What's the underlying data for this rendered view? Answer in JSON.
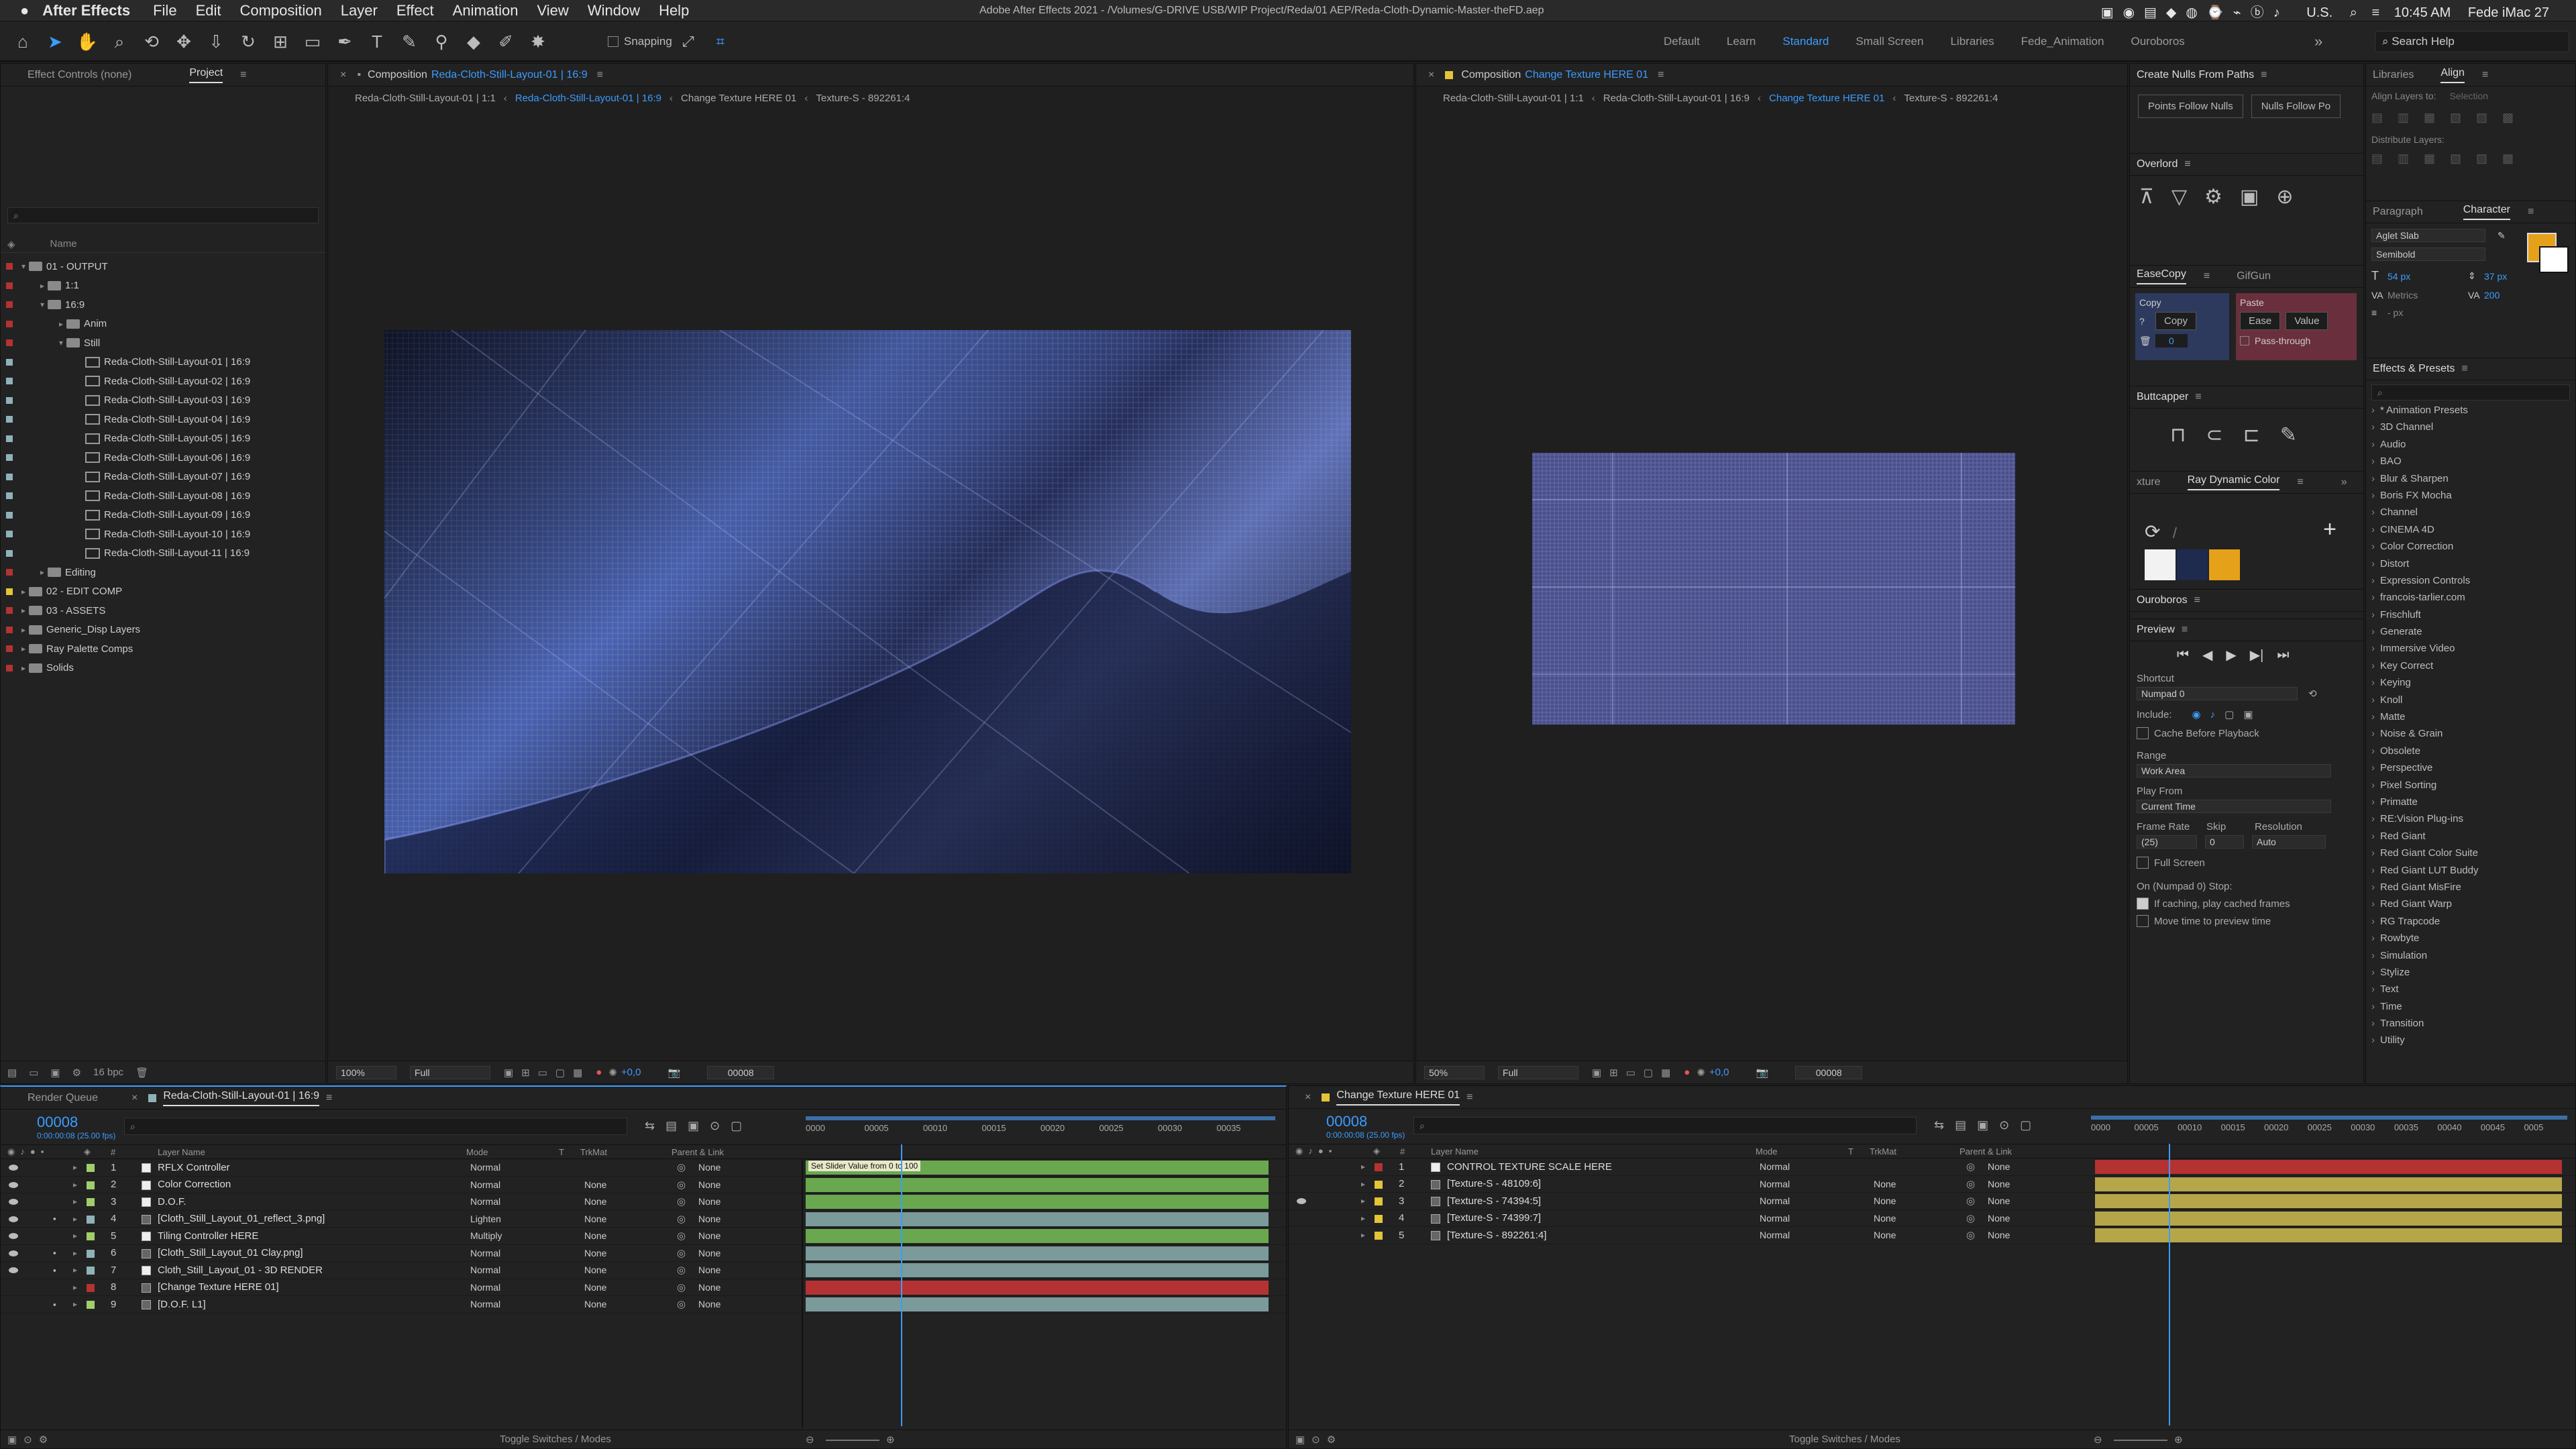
{
  "menubar": {
    "apple": "",
    "app": "After Effects",
    "items": [
      "File",
      "Edit",
      "Composition",
      "Layer",
      "Effect",
      "Animation",
      "View",
      "Window",
      "Help"
    ],
    "title": "Adobe After Effects 2021 - /Volumes/G-DRIVE USB/WIP Project/Reda/01 AEP/Reda-Cloth-Dynamic-Master-theFD.aep",
    "status": {
      "region": "U.S.",
      "time": "10:45 AM",
      "user": "Fede iMac 27"
    }
  },
  "toolbar": {
    "snapping": "Snapping",
    "workspaces": [
      "Default",
      "Learn",
      "Standard",
      "Small Screen",
      "Libraries",
      "Fede_Animation",
      "Ouroboros"
    ],
    "active_workspace": "Standard",
    "search": "Search Help"
  },
  "project_panel": {
    "tabs": [
      "Effect Controls (none)",
      "Project"
    ],
    "col_name": "Name",
    "search_placeholder": "",
    "items": [
      {
        "label": "01 - OUTPUT",
        "indent": 0,
        "type": "folder",
        "color": "#b43232",
        "open": true
      },
      {
        "label": "1:1",
        "indent": 1,
        "type": "folder",
        "color": "#b43232",
        "open": false
      },
      {
        "label": "16:9",
        "indent": 1,
        "type": "folder",
        "color": "#b43232",
        "open": true
      },
      {
        "label": "Anim",
        "indent": 2,
        "type": "folder",
        "color": "#b43232",
        "open": false
      },
      {
        "label": "Still",
        "indent": 2,
        "type": "folder",
        "color": "#b43232",
        "open": true
      },
      {
        "label": "Reda-Cloth-Still-Layout-01 | 16:9",
        "indent": 3,
        "type": "comp",
        "color": "#8fb2b9"
      },
      {
        "label": "Reda-Cloth-Still-Layout-02 | 16:9",
        "indent": 3,
        "type": "comp",
        "color": "#8fb2b9"
      },
      {
        "label": "Reda-Cloth-Still-Layout-03 | 16:9",
        "indent": 3,
        "type": "comp",
        "color": "#8fb2b9"
      },
      {
        "label": "Reda-Cloth-Still-Layout-04 | 16:9",
        "indent": 3,
        "type": "comp",
        "color": "#8fb2b9"
      },
      {
        "label": "Reda-Cloth-Still-Layout-05 | 16:9",
        "indent": 3,
        "type": "comp",
        "color": "#8fb2b9"
      },
      {
        "label": "Reda-Cloth-Still-Layout-06 | 16:9",
        "indent": 3,
        "type": "comp",
        "color": "#8fb2b9"
      },
      {
        "label": "Reda-Cloth-Still-Layout-07 | 16:9",
        "indent": 3,
        "type": "comp",
        "color": "#8fb2b9"
      },
      {
        "label": "Reda-Cloth-Still-Layout-08 | 16:9",
        "indent": 3,
        "type": "comp",
        "color": "#8fb2b9"
      },
      {
        "label": "Reda-Cloth-Still-Layout-09 | 16:9",
        "indent": 3,
        "type": "comp",
        "color": "#8fb2b9"
      },
      {
        "label": "Reda-Cloth-Still-Layout-10 | 16:9",
        "indent": 3,
        "type": "comp",
        "color": "#8fb2b9"
      },
      {
        "label": "Reda-Cloth-Still-Layout-11 | 16:9",
        "indent": 3,
        "type": "comp",
        "color": "#8fb2b9"
      },
      {
        "label": "Editing",
        "indent": 1,
        "type": "folder",
        "color": "#b43232",
        "open": false
      },
      {
        "label": "02 - EDIT COMP",
        "indent": 0,
        "type": "folder",
        "color": "#e3c537",
        "open": false
      },
      {
        "label": "03 - ASSETS",
        "indent": 0,
        "type": "folder",
        "color": "#b43232",
        "open": false
      },
      {
        "label": "Generic_Disp Layers",
        "indent": 0,
        "type": "folder",
        "color": "#b43232",
        "open": false
      },
      {
        "label": "Ray Palette Comps",
        "indent": 0,
        "type": "folder",
        "color": "#b43232",
        "open": false
      },
      {
        "label": "Solids",
        "indent": 0,
        "type": "folder",
        "color": "#b43232",
        "open": false
      }
    ],
    "bpc": "16 bpc"
  },
  "viewer_left": {
    "title_prefix": "Composition",
    "title": "Reda-Cloth-Still-Layout-01 | 16:9",
    "crumbs": [
      "Reda-Cloth-Still-Layout-01 | 1:1",
      "Reda-Cloth-Still-Layout-01 | 16:9",
      "Change Texture HERE 01",
      "Texture-S - 892261:4"
    ],
    "zoom": "100%",
    "res": "Full",
    "exposure": "+0,0",
    "frame": "00008"
  },
  "viewer_right": {
    "title_prefix": "Composition",
    "title": "Change Texture HERE 01",
    "crumbs": [
      "Reda-Cloth-Still-Layout-01 | 1:1",
      "Reda-Cloth-Still-Layout-01 | 16:9",
      "Change Texture HERE 01",
      "Texture-S - 892261:4"
    ],
    "zoom": "50%",
    "res": "Full",
    "exposure": "+0,0",
    "frame": "00008"
  },
  "right_col": {
    "nulls": {
      "title": "Create Nulls From Paths",
      "b1": "Points Follow Nulls",
      "b2": "Nulls Follow Po"
    },
    "overlord": "Overlord",
    "easecopy": {
      "tabs": [
        "EaseCopy",
        "GifGun"
      ],
      "copy": "Copy",
      "copy_btn": "Copy",
      "q": "?",
      "num": "0",
      "paste": "Paste",
      "ease": "Ease",
      "value": "Value",
      "pass": "Pass-through"
    },
    "buttcapper": "Buttcapper",
    "raydyn": {
      "tab_left": "xture",
      "title": "Ray Dynamic Color"
    },
    "ouroboros": "Ouroboros",
    "preview": {
      "title": "Preview",
      "shortcut_label": "Shortcut",
      "shortcut": "Numpad 0",
      "include": "Include:",
      "cache": "Cache Before Playback",
      "range_label": "Range",
      "range": "Work Area",
      "playfrom_label": "Play From",
      "playfrom": "Current Time",
      "fr_label": "Frame Rate",
      "skip_label": "Skip",
      "res_label": "Resolution",
      "fr": "(25)",
      "skip": "0",
      "res": "Auto",
      "fullscreen": "Full Screen",
      "stop_label": "On (Numpad 0) Stop:",
      "opt1": "If caching, play cached frames",
      "opt2": "Move time to preview time"
    }
  },
  "far_right": {
    "tabs": [
      "Libraries",
      "Align"
    ],
    "align_to": "Align Layers to:",
    "selection": "Selection",
    "distribute": "Distribute Layers:",
    "para_tabs": [
      "Paragraph",
      "Character"
    ],
    "font": "Aglet Slab",
    "style": "Semibold",
    "size": "54 px",
    "leading": "37 px",
    "metrics": "Metrics",
    "tracking": "200",
    "unit": "- px",
    "effects_title": "Effects & Presets",
    "effects": [
      "* Animation Presets",
      "3D Channel",
      "Audio",
      "BAO",
      "Blur & Sharpen",
      "Boris FX Mocha",
      "Channel",
      "CINEMA 4D",
      "Color Correction",
      "Distort",
      "Expression Controls",
      "francois-tarlier.com",
      "Frischluft",
      "Generate",
      "Immersive Video",
      "Key Correct",
      "Keying",
      "Knoll",
      "Matte",
      "Noise & Grain",
      "Obsolete",
      "Perspective",
      "Pixel Sorting",
      "Primatte",
      "RE:Vision Plug-ins",
      "Red Giant",
      "Red Giant Color Suite",
      "Red Giant LUT Buddy",
      "Red Giant MisFire",
      "Red Giant Warp",
      "RG Trapcode",
      "Rowbyte",
      "Simulation",
      "Stylize",
      "Text",
      "Time",
      "Transition",
      "Utility"
    ]
  },
  "timeline_left": {
    "tabs": [
      "Render Queue",
      "Reda-Cloth-Still-Layout-01 | 16:9"
    ],
    "timecode": "00008",
    "fps": "0:00:00:08 (25.00 fps)",
    "cols": {
      "name": "Layer Name",
      "mode": "Mode",
      "t": "T",
      "trk": "TrkMat",
      "parent": "Parent & Link"
    },
    "ruler": [
      "0000",
      "00005",
      "00010",
      "00015",
      "00020",
      "00025",
      "00030",
      "00035"
    ],
    "tooltip": "Set Slider Value from 0 to 100",
    "layers": [
      {
        "n": "1",
        "name": "RFLX Controller",
        "mode": "Normal",
        "trk": "",
        "parent": "None",
        "color": "#9fcf6b",
        "bar": "#6aa84f",
        "eye": true,
        "lock": false
      },
      {
        "n": "2",
        "name": "Color Correction",
        "mode": "Normal",
        "trk": "None",
        "parent": "None",
        "color": "#9fcf6b",
        "bar": "#6aa84f",
        "eye": true,
        "lock": false
      },
      {
        "n": "3",
        "name": "D.O.F.",
        "mode": "Normal",
        "trk": "None",
        "parent": "None",
        "color": "#9fcf6b",
        "bar": "#6aa84f",
        "eye": true,
        "lock": false
      },
      {
        "n": "4",
        "name": "[Cloth_Still_Layout_01_reflect_3.png]",
        "mode": "Lighten",
        "trk": "None",
        "parent": "None",
        "color": "#8fb2b9",
        "bar": "#7b9a9a",
        "eye": true,
        "lock": true
      },
      {
        "n": "5",
        "name": "Tiling Controller HERE",
        "mode": "Multiply",
        "trk": "None",
        "parent": "None",
        "color": "#9fcf6b",
        "bar": "#6aa84f",
        "eye": true,
        "lock": false
      },
      {
        "n": "6",
        "name": "[Cloth_Still_Layout_01 Clay.png]",
        "mode": "Normal",
        "trk": "None",
        "parent": "None",
        "color": "#8fb2b9",
        "bar": "#7b9a9a",
        "eye": true,
        "lock": true
      },
      {
        "n": "7",
        "name": "Cloth_Still_Layout_01 - 3D RENDER",
        "mode": "Normal",
        "trk": "None",
        "parent": "None",
        "color": "#8fb2b9",
        "bar": "#7b9a9a",
        "eye": true,
        "lock": true
      },
      {
        "n": "8",
        "name": "[Change Texture HERE 01]",
        "mode": "Normal",
        "trk": "None",
        "parent": "None",
        "color": "#b43232",
        "bar": "#b43232",
        "eye": false,
        "lock": false
      },
      {
        "n": "9",
        "name": "[D.O.F. L1]",
        "mode": "Normal",
        "trk": "None",
        "parent": "None",
        "color": "#9fcf6b",
        "bar": "#7b9a9a",
        "eye": false,
        "lock": true
      }
    ],
    "toggle": "Toggle Switches / Modes"
  },
  "timeline_right": {
    "tab": "Change Texture HERE 01",
    "timecode": "00008",
    "fps": "0:00:00:08 (25.00 fps)",
    "cols": {
      "name": "Layer Name",
      "mode": "Mode",
      "t": "T",
      "trk": "TrkMat",
      "parent": "Parent & Link"
    },
    "ruler": [
      "0000",
      "00005",
      "00010",
      "00015",
      "00020",
      "00025",
      "00030",
      "00035",
      "00040",
      "00045",
      "0005"
    ],
    "layers": [
      {
        "n": "1",
        "name": "CONTROL TEXTURE SCALE HERE",
        "mode": "Normal",
        "trk": "",
        "parent": "None",
        "color": "#b43232",
        "bar": "#b43232",
        "eye": false
      },
      {
        "n": "2",
        "name": "[Texture-S - 48109:6]",
        "mode": "Normal",
        "trk": "None",
        "parent": "None",
        "color": "#e3c537",
        "bar": "#b6a64a",
        "eye": false
      },
      {
        "n": "3",
        "name": "[Texture-S - 74394:5]",
        "mode": "Normal",
        "trk": "None",
        "parent": "None",
        "color": "#e3c537",
        "bar": "#b6a64a",
        "eye": true
      },
      {
        "n": "4",
        "name": "[Texture-S - 74399:7]",
        "mode": "Normal",
        "trk": "None",
        "parent": "None",
        "color": "#e3c537",
        "bar": "#b6a64a",
        "eye": false
      },
      {
        "n": "5",
        "name": "[Texture-S - 892261:4]",
        "mode": "Normal",
        "trk": "None",
        "parent": "None",
        "color": "#e3c537",
        "bar": "#b6a64a",
        "eye": false
      }
    ],
    "toggle": "Toggle Switches / Modes"
  }
}
